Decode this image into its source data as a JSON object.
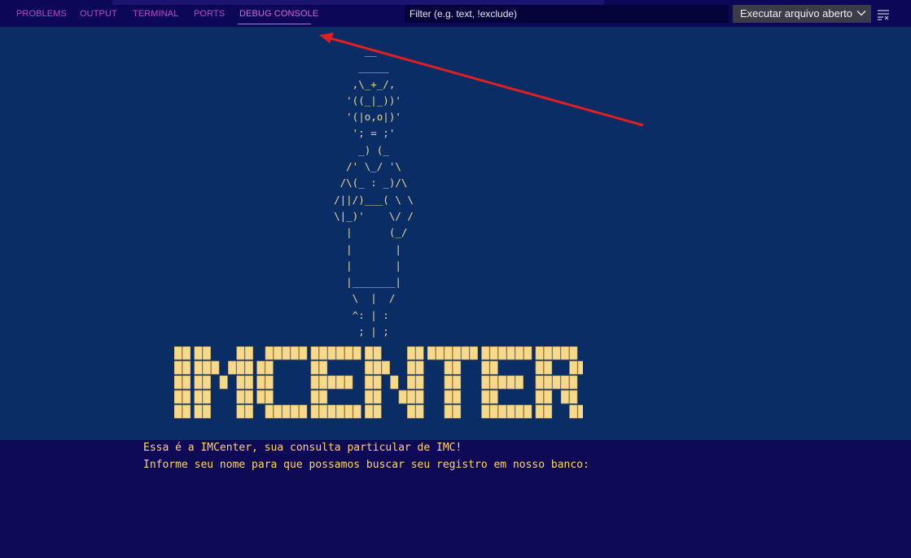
{
  "panel_tabs": [
    {
      "label": "PROBLEMS"
    },
    {
      "label": "OUTPUT"
    },
    {
      "label": "TERMINAL"
    },
    {
      "label": "PORTS"
    },
    {
      "label": "DEBUG CONSOLE",
      "active": true
    }
  ],
  "filter": {
    "placeholder": "Filter (e.g. text, !exclude)",
    "value": ""
  },
  "launch_select": {
    "selected": "Executar arquivo aberto"
  },
  "ascii_art": "         __\n        _____\n       ,\\_+_/,\n      '((_|_))'\n      '(|o,o|)'\n       '; = ;'\n        _) (_\n      /' \\_/ '\\\n     /\\(_ : _)/\\\n    /||/)___( \\ \\\n    \\|_)'    \\/ /\n      |      (_/\n      |       |\n      |       |\n      |_______|\n       \\  |  /\n       ^: | :\n        ; | ;",
  "logo_text": "IMCENTER",
  "console_lines": [
    "Essa é a IMCenter, sua consulta particular de IMC!",
    "Informe seu nome para que possamos buscar seu registro em nosso banco:"
  ],
  "colors": {
    "accent_tab": "#d16ad9",
    "console_text": "#ffd766",
    "ascii": "#e8d896",
    "logo_fill": "#f6d98a",
    "annotation_arrow": "#e02020"
  },
  "icons": [
    "chevron-down-icon",
    "word-wrap-icon",
    "annotation-arrow"
  ]
}
